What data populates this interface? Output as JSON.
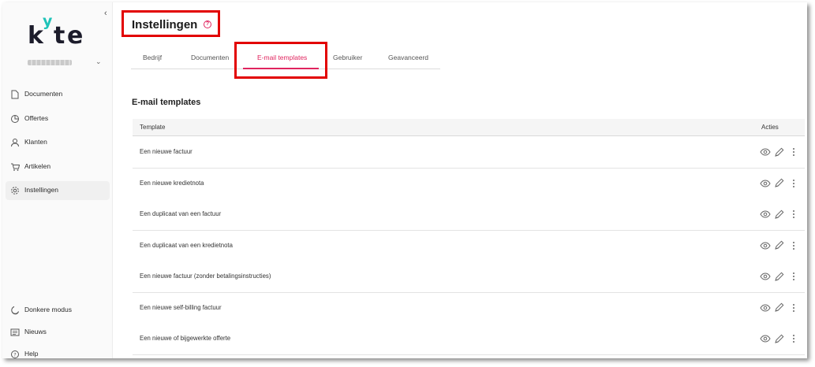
{
  "brand": {
    "logo_k": "k",
    "logo_y": "y",
    "logo_t": "t",
    "logo_e": "e",
    "accent": "#e0245e",
    "logo_accent": "#1fc3b8"
  },
  "sidebar": {
    "collapse_icon": "chevron-left-icon",
    "account_chevron": "chevron-down-icon",
    "items": [
      {
        "label": "Documenten",
        "icon": "document-icon"
      },
      {
        "label": "Offertes",
        "icon": "quote-icon"
      },
      {
        "label": "Klanten",
        "icon": "user-icon"
      },
      {
        "label": "Artikelen",
        "icon": "cart-icon"
      },
      {
        "label": "Instellingen",
        "icon": "gear-icon",
        "active": true
      }
    ],
    "bottom_items": [
      {
        "label": "Donkere modus",
        "icon": "moon-icon"
      },
      {
        "label": "Nieuws",
        "icon": "news-icon"
      },
      {
        "label": "Help",
        "icon": "help-icon"
      }
    ]
  },
  "header": {
    "title": "Instellingen",
    "help_icon": "question-circle-icon"
  },
  "tabs": [
    {
      "label": "Bedrijf"
    },
    {
      "label": "Documenten"
    },
    {
      "label": "E-mail templates",
      "active": true
    },
    {
      "label": "Gebruiker"
    },
    {
      "label": "Geavanceerd"
    }
  ],
  "section": {
    "title": "E-mail templates"
  },
  "table": {
    "columns": {
      "template": "Template",
      "actions": "Acties"
    },
    "rows": [
      "Een nieuwe factuur",
      "Een nieuwe kredietnota",
      "Een duplicaat van een factuur",
      "Een duplicaat van een kredietnota",
      "Een nieuwe factuur (zonder betalingsinstructies)",
      "Een nieuwe self-billing factuur",
      "Een nieuwe of bijgewerkte offerte"
    ],
    "row_actions": [
      "eye-icon",
      "pencil-icon",
      "more-vertical-icon"
    ]
  }
}
